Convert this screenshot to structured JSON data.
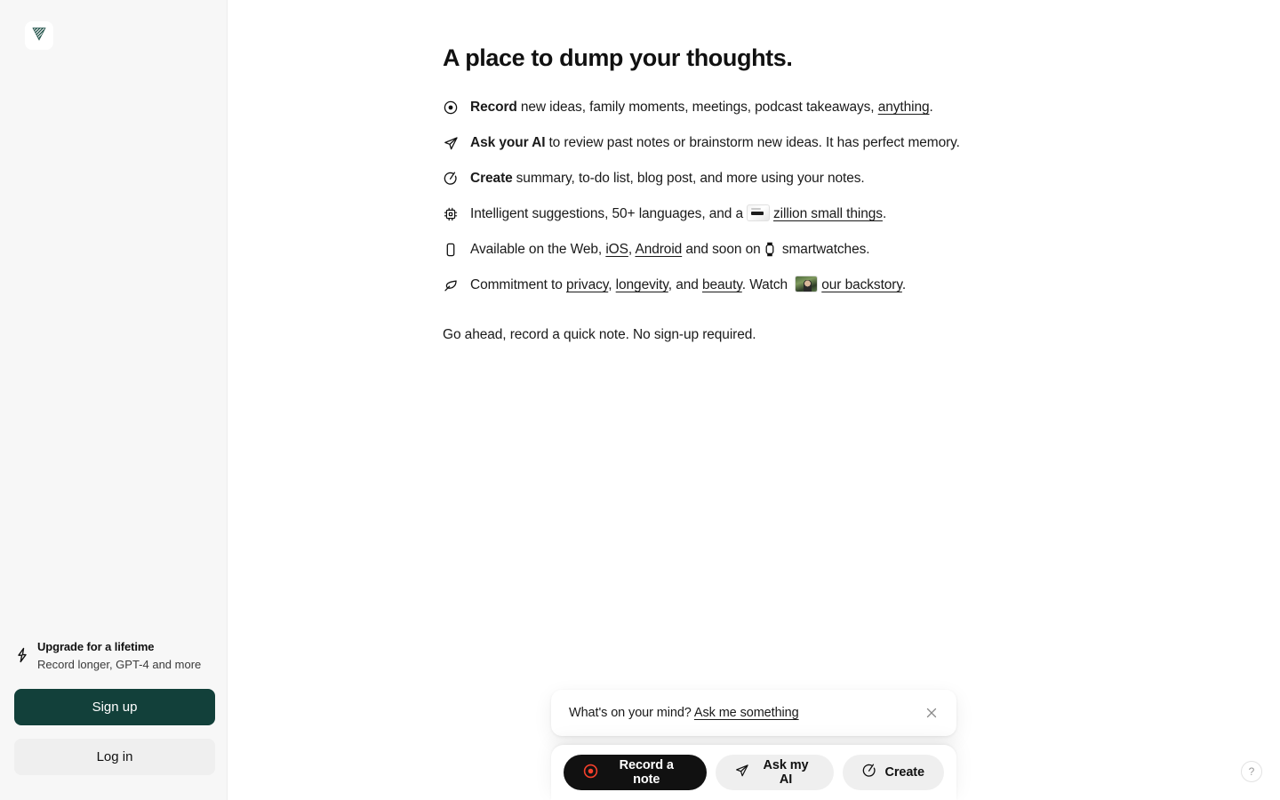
{
  "brand": {
    "logo_name": "logo-chevron",
    "accent_green": "#12403a",
    "accent_red": "#f5402c"
  },
  "sidebar": {
    "upgrade": {
      "icon": "lightning-bolt-icon",
      "title": "Upgrade for a lifetime",
      "subtitle": "Record longer, GPT-4 and more"
    },
    "signup_label": "Sign up",
    "login_label": "Log in"
  },
  "main": {
    "title": "A place to dump your thoughts.",
    "features": [
      {
        "icon": "record-circle-icon",
        "lead": "Record",
        "text_before": "new ideas, family moments, meetings, podcast takeaways, ",
        "link": "anything",
        "text_after": "."
      },
      {
        "icon": "send-plane-icon",
        "lead": "Ask your AI",
        "text_before": "to review past notes or brainstorm new ideas. It has perfect memory.",
        "link": "",
        "text_after": ""
      },
      {
        "icon": "magic-circle-slash-icon",
        "lead": "Create",
        "text_before": "summary, to-do list, blog post, and more using your notes.",
        "link": "",
        "text_after": ""
      },
      {
        "icon": "cpu-chip-icon",
        "lead": "",
        "text_before": "Intelligent suggestions, 50+ languages, and a",
        "link": "zillion small things",
        "text_after": "."
      },
      {
        "icon": "smartphone-icon",
        "lead": "",
        "text_before": "Available on the Web, ",
        "link": "iOS",
        "text_after": " smartwatches."
      },
      {
        "icon": "leaf-icon",
        "lead": "",
        "text_before": "Commitment to ",
        "link": "privacy",
        "text_after": "."
      }
    ],
    "row5": {
      "prefix": "Available on the Web, ",
      "link_ios": "iOS",
      "comma": ", ",
      "link_android": "Android",
      "middle": " and soon on",
      "watch_icon": "smartwatch-icon",
      "suffix": " smartwatches."
    },
    "row6": {
      "prefix": "Commitment to ",
      "link_privacy": "privacy",
      "sep1": ", ",
      "link_longevity": "longevity",
      "sep2": ", and ",
      "link_beauty": "beauty",
      "sep3": ". Watch ",
      "thumb": "backstory-thumbnail",
      "link_backstory": "our backstory",
      "suffix": "."
    },
    "closing_line": "Go ahead, record a quick note. No sign-up required."
  },
  "dock": {
    "prompt_question": "What's on your mind? ",
    "prompt_link": "Ask me something",
    "close_icon": "close-icon",
    "buttons": [
      {
        "label": "Record a note",
        "icon": "record-circle-icon"
      },
      {
        "label": "Ask my AI",
        "icon": "send-plane-icon"
      },
      {
        "label": "Create",
        "icon": "magic-circle-slash-icon"
      }
    ]
  },
  "help": {
    "label": "?"
  }
}
